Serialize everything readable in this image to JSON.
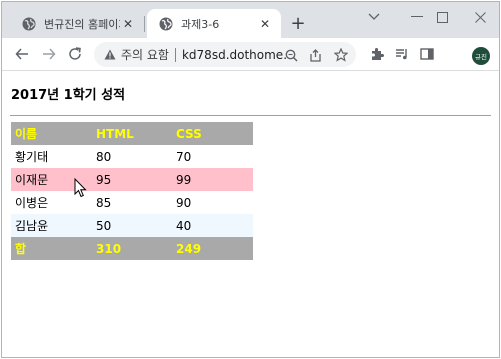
{
  "browser": {
    "tabs": [
      {
        "title": "변규진의 홈페이지",
        "active": false
      },
      {
        "title": "과제3-6",
        "active": true
      }
    ],
    "address": {
      "warning": "주의 요함",
      "url": "kd78sd.dothome.co.kr"
    },
    "profile_initials": "규진"
  },
  "page": {
    "title": "2017년 1학기 성적",
    "table": {
      "header": [
        "이름",
        "HTML",
        "CSS"
      ],
      "rows": [
        [
          "황기태",
          "80",
          "70"
        ],
        [
          "이재문",
          "95",
          "99"
        ],
        [
          "이병은",
          "85",
          "90"
        ],
        [
          "김남윤",
          "50",
          "40"
        ]
      ],
      "footer": [
        "합",
        "310",
        "249"
      ]
    }
  },
  "colors": {
    "header_bg": "#a9a9a9",
    "header_text": "#ffff00",
    "highlight_row": "#ffc0cb",
    "alt_row": "#f0f8ff"
  },
  "icons": [
    "globe-icon",
    "close-icon",
    "plus-icon",
    "minimize-icon",
    "maximize-icon",
    "chevron-down-icon",
    "back-arrow-icon",
    "forward-arrow-icon",
    "reload-icon",
    "warning-icon",
    "zoom-icon",
    "share-icon",
    "star-icon",
    "extensions-icon",
    "media-icon",
    "side-panel-icon",
    "cursor-icon"
  ]
}
